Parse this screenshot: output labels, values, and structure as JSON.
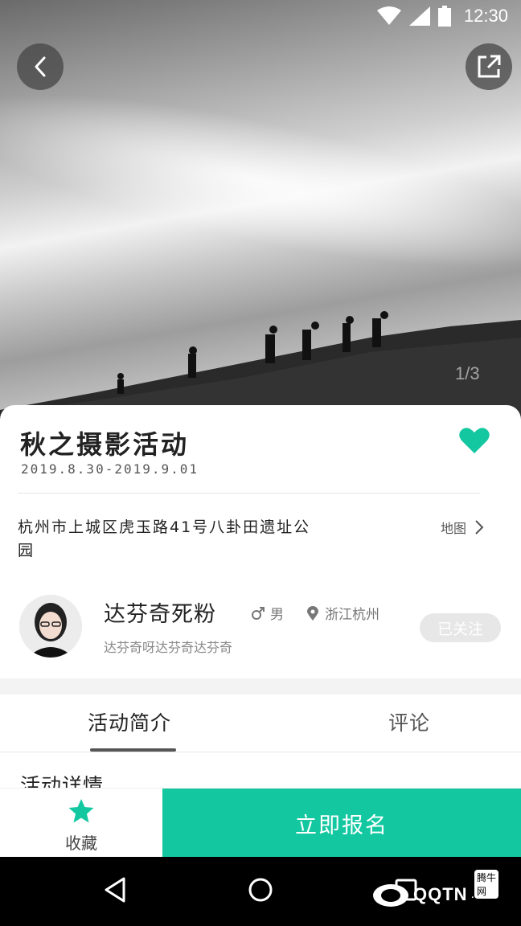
{
  "status_bar": {
    "time": "12:30"
  },
  "hero": {
    "page_indicator": "1/3"
  },
  "event": {
    "title": "秋之摄影活动",
    "date_range": "2019.8.30-2019.9.01",
    "address": "杭州市上城区虎玉路41号八卦田遗址公园",
    "map_label": "地图",
    "accent_color": "#13c8a0"
  },
  "organizer": {
    "name": "达芬奇死粉",
    "gender": "男",
    "location": "浙江杭州",
    "bio": "达芬奇呀达芬奇达芬奇",
    "follow_label": "已关注"
  },
  "tabs": [
    {
      "label": "活动简介",
      "active": true
    },
    {
      "label": "评论",
      "active": false
    }
  ],
  "section": {
    "heading": "活动详情"
  },
  "bottom_bar": {
    "favorite_label": "收藏",
    "signup_label": "立即报名"
  },
  "watermark": {
    "text": "QQTN",
    "suffix": ".com",
    "badge": "腾牛网"
  }
}
